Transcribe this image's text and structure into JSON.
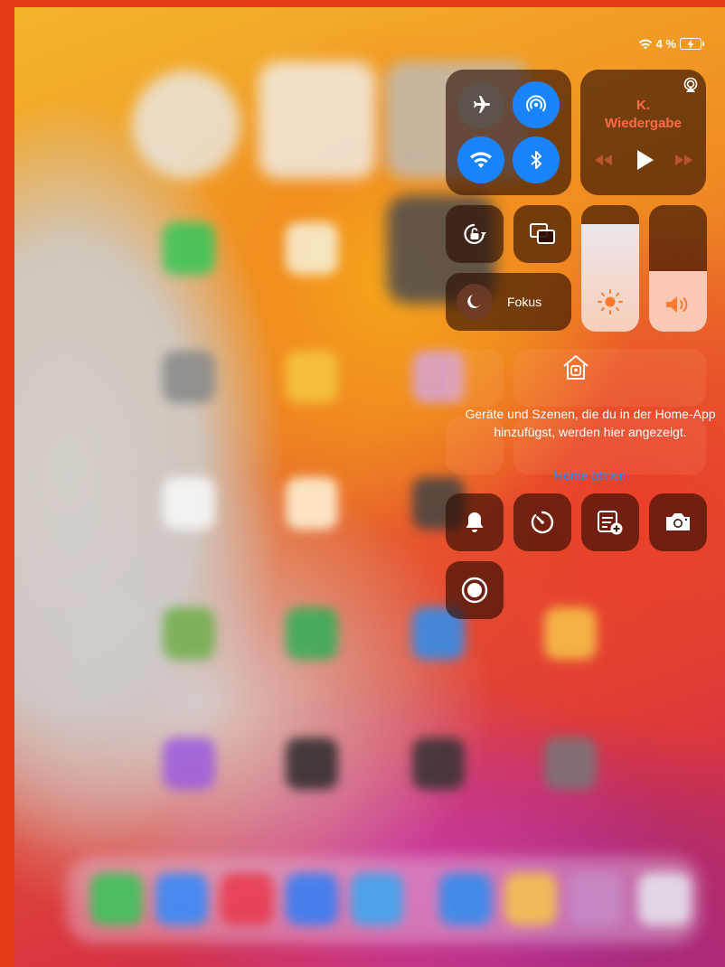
{
  "status_bar": {
    "battery_text": "4 %"
  },
  "control_center": {
    "connectivity": {
      "airplane_mode": false,
      "airdrop": true,
      "wifi": true,
      "bluetooth": true
    },
    "media": {
      "title": "K.",
      "subtitle": "Wiedergabe"
    },
    "focus": {
      "label": "Fokus"
    },
    "brightness_level": 0.85,
    "volume_level": 0.48,
    "home": {
      "message": "Geräte und Szenen, die du in der Home-App hinzufügst, werden hier angezeigt.",
      "link": "Home öffnen"
    }
  },
  "colors": {
    "accent_blue": "#1a84ff",
    "media_title": "#ff6b4a",
    "link_blue": "#2f8bff",
    "border_red": "#e23a12"
  }
}
